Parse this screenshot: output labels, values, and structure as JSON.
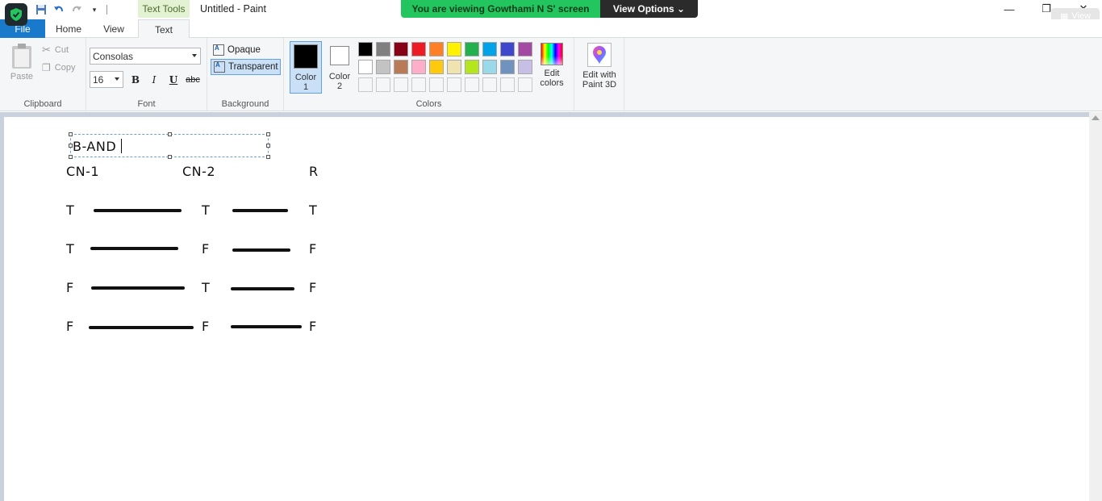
{
  "window": {
    "title": "Untitled - Paint",
    "contextual_tab_header": "Text Tools",
    "min_glyph": "—",
    "max_glyph": "❐",
    "close_glyph": "✕"
  },
  "share_banner": {
    "message": "You are viewing Gowthami N S' screen",
    "view_options": "View Options ⌄",
    "view_button": "View"
  },
  "tabs": {
    "file": "File",
    "home": "Home",
    "view": "View",
    "text": "Text"
  },
  "help": "?",
  "ribbon": {
    "clipboard": {
      "label": "Clipboard",
      "paste": "Paste",
      "cut": "Cut",
      "copy": "Copy"
    },
    "font": {
      "label": "Font",
      "family": "Consolas",
      "size": "16",
      "bold": "B",
      "italic": "I",
      "underline": "U",
      "strike": "abc"
    },
    "background": {
      "label": "Background",
      "opaque": "Opaque",
      "transparent": "Transparent"
    },
    "colors": {
      "label": "Colors",
      "color1_label": "Color 1",
      "color2_label": "Color 2",
      "edit_colors": "Edit colors",
      "color1": "#000000",
      "color2": "#ffffff",
      "palette_row1": [
        "#000000",
        "#7f7f7f",
        "#880015",
        "#ed1c24",
        "#ff7f27",
        "#fff200",
        "#22b14c",
        "#00a2e8",
        "#3f48cc",
        "#a349a4"
      ],
      "palette_row2": [
        "#ffffff",
        "#c3c3c3",
        "#b97a57",
        "#ffaec9",
        "#ffc90e",
        "#efe4b0",
        "#b5e61d",
        "#99d9ea",
        "#7092be",
        "#c8bfe7"
      ]
    },
    "paint3d": {
      "label": "Edit with Paint 3D"
    }
  },
  "canvas": {
    "textbox_value": "B-AND",
    "headers": [
      "CN-1",
      "CN-2",
      "R"
    ],
    "rows": [
      {
        "a": "T",
        "b": "T",
        "r": "T"
      },
      {
        "a": "T",
        "b": "F",
        "r": "F"
      },
      {
        "a": "F",
        "b": "T",
        "r": "F"
      },
      {
        "a": "F",
        "b": "F",
        "r": "F"
      }
    ]
  }
}
